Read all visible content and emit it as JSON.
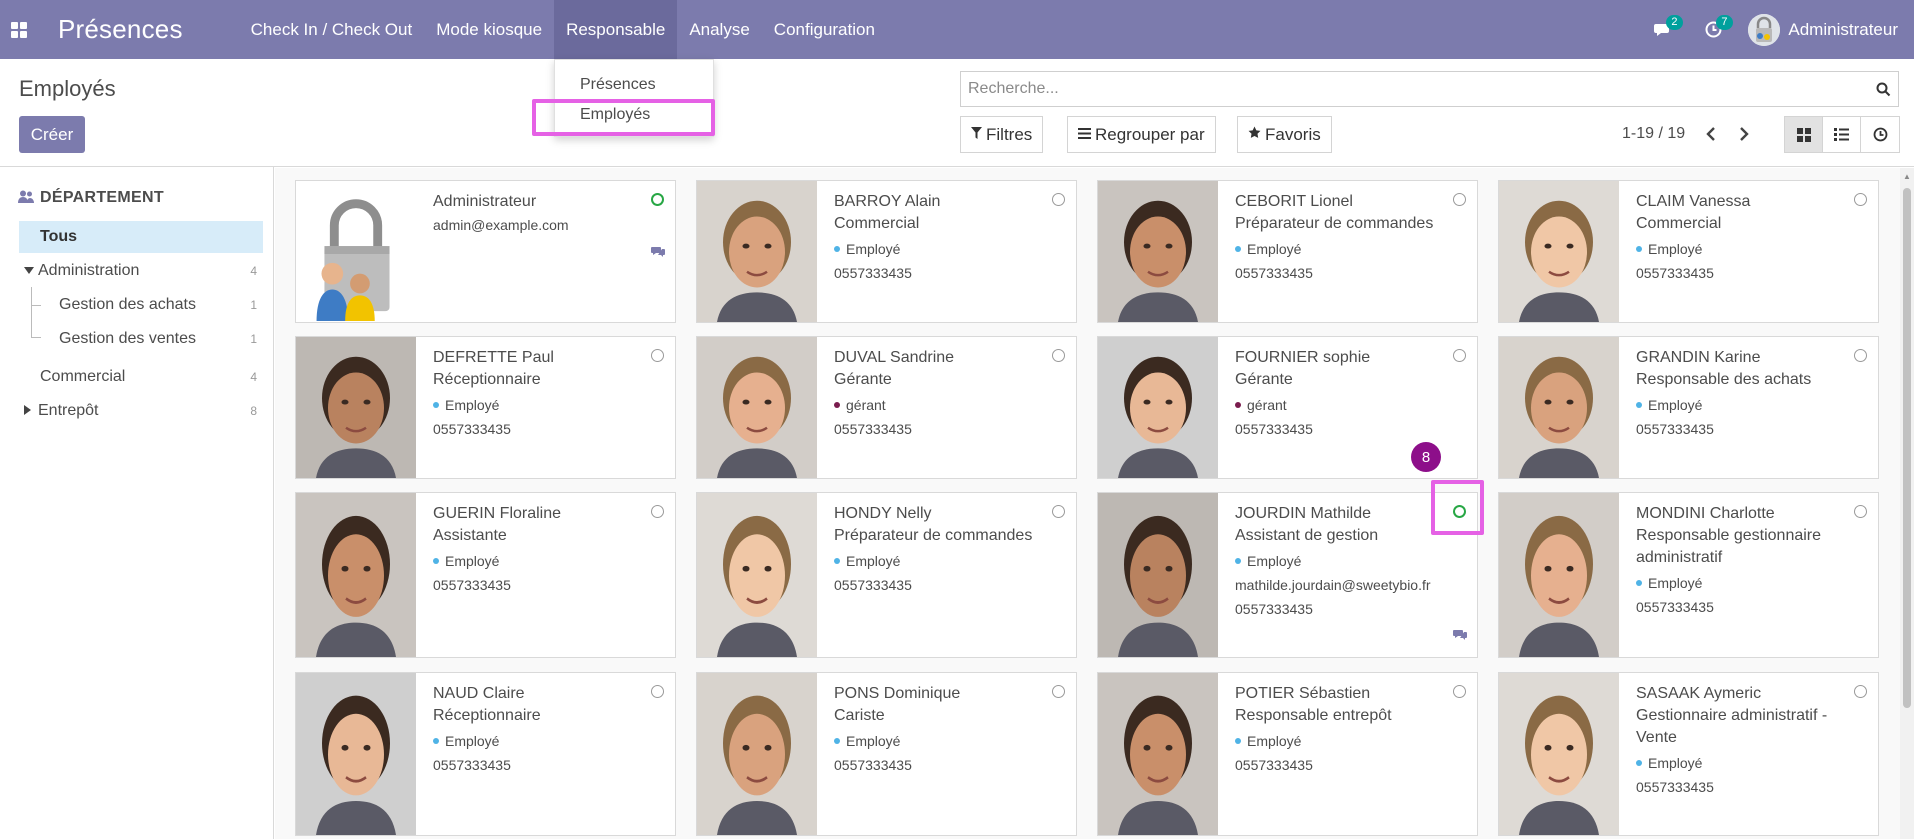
{
  "app": {
    "title": "Présences"
  },
  "nav": {
    "items": [
      {
        "label": "Check In / Check Out"
      },
      {
        "label": "Mode kiosque"
      },
      {
        "label": "Responsable"
      },
      {
        "label": "Analyse"
      },
      {
        "label": "Configuration"
      }
    ],
    "messages_count": "2",
    "activities_count": "7",
    "user": "Administrateur"
  },
  "dropdown": {
    "items": [
      {
        "label": "Présences"
      },
      {
        "label": "Employés"
      }
    ]
  },
  "control": {
    "breadcrumb": "Employés",
    "create": "Créer",
    "search_placeholder": "Recherche...",
    "filters": "Filtres",
    "group_by": "Regrouper par",
    "favorites": "Favoris",
    "pager": "1-19 / 19"
  },
  "sidebar": {
    "title": "DÉPARTEMENT",
    "all": "Tous",
    "items": [
      {
        "label": "Administration",
        "count": "4"
      },
      {
        "label": "Gestion des achats",
        "count": "1"
      },
      {
        "label": "Gestion des ventes",
        "count": "1"
      },
      {
        "label": "Commercial",
        "count": "4"
      },
      {
        "label": "Entrepôt",
        "count": "8"
      }
    ]
  },
  "step_badge": "8",
  "employees": [
    {
      "name": "Administrateur",
      "email": "admin@example.com"
    },
    {
      "name": "BARROY Alain",
      "job": "Commercial",
      "tag": "Employé",
      "phone": "0557333435"
    },
    {
      "name": "CEBORIT Lionel",
      "job": "Préparateur de commandes",
      "tag": "Employé",
      "phone": "0557333435"
    },
    {
      "name": "CLAIM Vanessa",
      "job": "Commercial",
      "tag": "Employé",
      "phone": "0557333435"
    },
    {
      "name": "DEFRETTE Paul",
      "job": "Réceptionnaire",
      "tag": "Employé",
      "phone": "0557333435"
    },
    {
      "name": "DUVAL Sandrine",
      "job": "Gérante",
      "tag": "gérant",
      "phone": "0557333435"
    },
    {
      "name": "FOURNIER sophie",
      "job": "Gérante",
      "tag": "gérant",
      "phone": "0557333435"
    },
    {
      "name": "GRANDIN Karine",
      "job": "Responsable des achats",
      "tag": "Employé",
      "phone": "0557333435"
    },
    {
      "name": "GUERIN Floraline",
      "job": "Assistante",
      "tag": "Employé",
      "phone": "0557333435"
    },
    {
      "name": "HONDY Nelly",
      "job": "Préparateur de commandes",
      "tag": "Employé",
      "phone": "0557333435"
    },
    {
      "name": "JOURDIN Mathilde",
      "job": "Assistant de gestion",
      "tag": "Employé",
      "email": "mathilde.jourdain@sweetybio.fr",
      "phone": "0557333435"
    },
    {
      "name": "MONDINI Charlotte",
      "job": "Responsable gestionnaire administratif",
      "tag": "Employé",
      "phone": "0557333435"
    },
    {
      "name": "NAUD Claire",
      "job": "Réceptionnaire",
      "tag": "Employé",
      "phone": "0557333435"
    },
    {
      "name": "PONS Dominique",
      "job": "Cariste",
      "tag": "Employé",
      "phone": "0557333435"
    },
    {
      "name": "POTIER Sébastien",
      "job": "Responsable entrepôt",
      "tag": "Employé",
      "phone": "0557333435"
    },
    {
      "name": "SASAAK Aymeric",
      "job": "Gestionnaire administratif - Vente",
      "tag": "Employé",
      "phone": "0557333435"
    }
  ]
}
